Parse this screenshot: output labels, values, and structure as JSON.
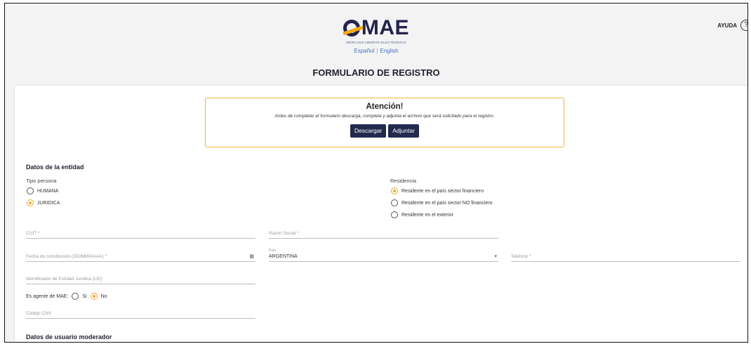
{
  "header": {
    "brand": "MAE",
    "brand_subtitle": "MERCADO ABIERTO ELECTRÓNICO",
    "lang_es": "Español",
    "lang_sep": "|",
    "lang_en": "English",
    "form_title": "FORMULARIO DE REGISTRO",
    "help_label": "AYUDA",
    "help_icon": "?"
  },
  "alert": {
    "title": "Atención!",
    "text": "Antes de completar el formulario descarga, completa y adjunta el archivo que será solicitado para el registro.",
    "download_label": "Descargar",
    "attach_label": "Adjuntar"
  },
  "entity": {
    "section_title": "Datos de la entidad",
    "tipo_persona_label": "Tipo persona",
    "tipo_options": [
      {
        "label": "HUMANA",
        "checked": false
      },
      {
        "label": "JURIDICA",
        "checked": true
      }
    ],
    "residencia_label": "Residencia",
    "residencia_options": [
      {
        "label": "Residente en el país sector financiero",
        "checked": true
      },
      {
        "label": "Residente en el país sector NO financiero",
        "checked": false
      },
      {
        "label": "Residente en el exterior",
        "checked": false
      }
    ],
    "cuit_placeholder": "CUIT *",
    "razon_social_placeholder": "Razón Social *",
    "fecha_placeholder": "Fecha de constitución (DD/MM/AAAA) *",
    "calendar_icon": "calendar-icon",
    "pais_label": "País",
    "pais_value": "ARGENTINA",
    "telefono_placeholder": "Telefono *",
    "lei_placeholder": "Identificador de Entidad Jurídica (LEI)",
    "agente_label": "Es agente de MAE:",
    "agente_options": [
      {
        "label": "Si",
        "checked": false
      },
      {
        "label": "No",
        "checked": true
      }
    ],
    "cnv_placeholder": "Código CNV"
  },
  "moderator": {
    "section_title": "Datos de usuario moderador"
  },
  "colors": {
    "accent": "#f1a72a",
    "button_bg": "#222a4e",
    "link": "#4573b9"
  }
}
